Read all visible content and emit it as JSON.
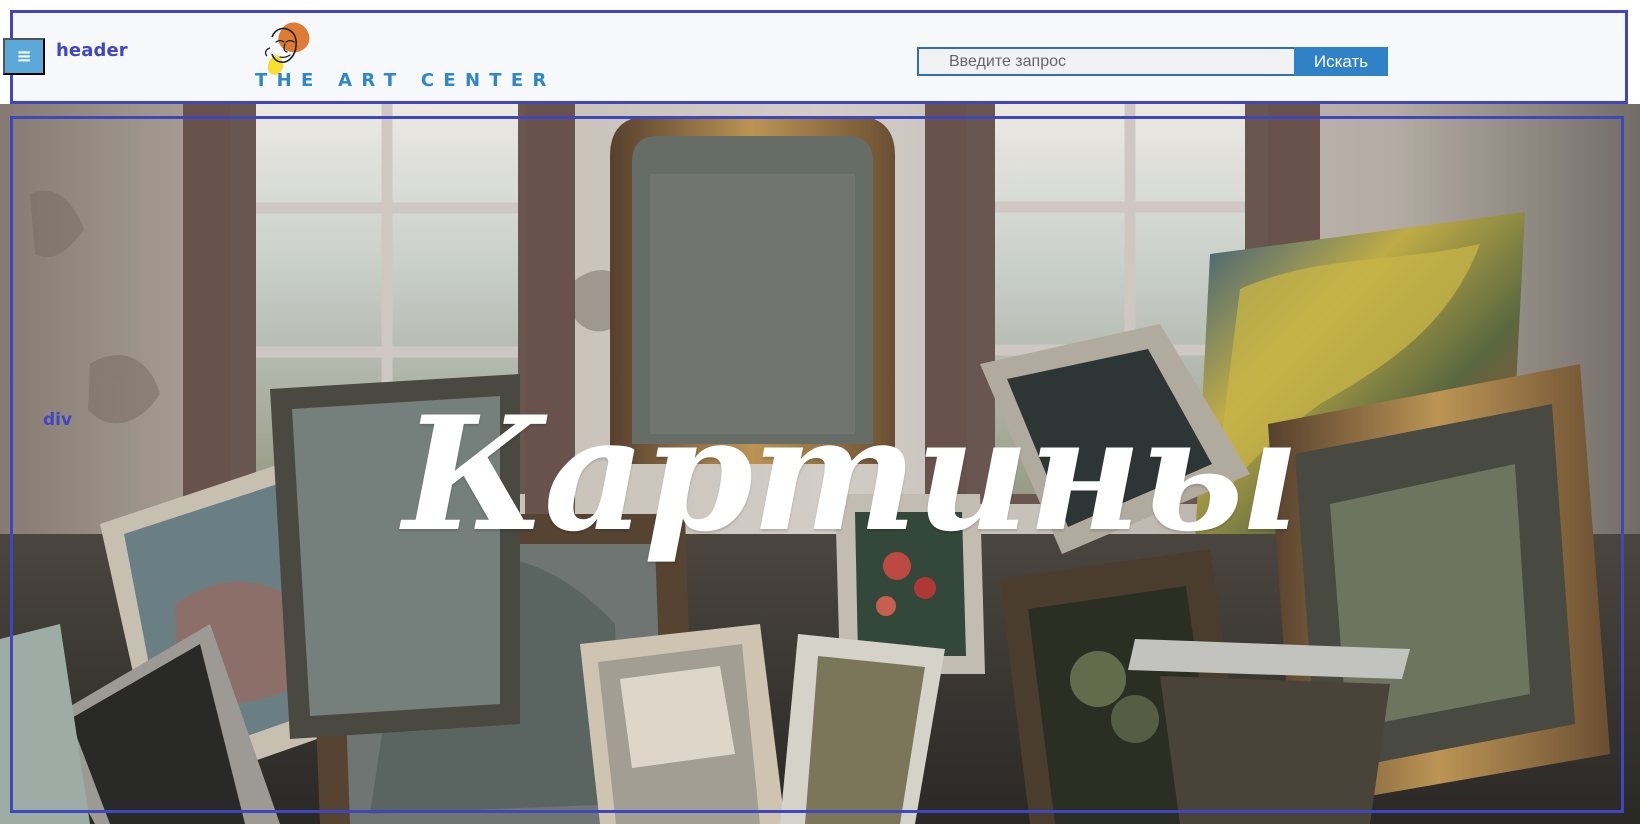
{
  "header": {
    "debug_label": "header",
    "menu_icon": "hamburger-menu-icon",
    "logo_text": "THE ART CENTER",
    "logo_icon": "abstract-face-logo-icon",
    "search": {
      "placeholder": "Введите запрос",
      "value": "",
      "button_label": "Искать"
    }
  },
  "hero": {
    "debug_label": "div",
    "title": "Картины"
  },
  "colors": {
    "debug_outline": "#3f46c0",
    "brand_blue": "#2f86c8",
    "search_button": "#2f82c5",
    "logo_orange": "#de7b35",
    "logo_yellow": "#f6df2e"
  }
}
